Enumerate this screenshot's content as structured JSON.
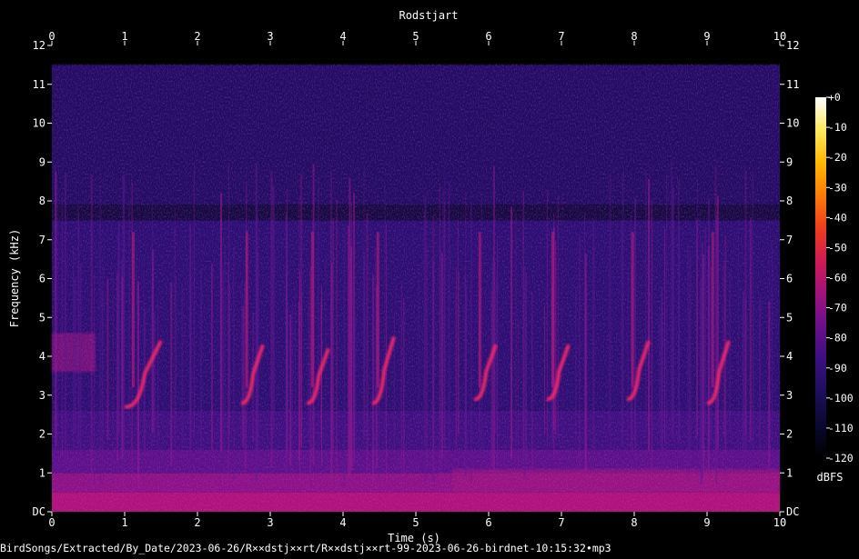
{
  "chart_data": {
    "type": "heatmap",
    "title": "Rodstjart",
    "xlabel": "Time (s)",
    "ylabel": "Frequency (kHz)",
    "xlim": [
      0,
      10
    ],
    "ylim": [
      0,
      12
    ],
    "x_ticks": [
      "0",
      "1",
      "2",
      "3",
      "4",
      "5",
      "6",
      "7",
      "8",
      "9",
      "10"
    ],
    "y_ticks": [
      "DC",
      "1",
      "2",
      "3",
      "4",
      "5",
      "6",
      "7",
      "8",
      "9",
      "10",
      "11",
      "12"
    ],
    "colorbar": {
      "label": "dBFS",
      "ticks": [
        "+0",
        "-10",
        "-20",
        "-30",
        "-40",
        "-50",
        "-60",
        "-70",
        "-80",
        "-90",
        "-100",
        "-110",
        "-120"
      ],
      "range": [
        -120,
        0
      ]
    },
    "signal_band_khz": [
      0,
      11.5
    ],
    "song_phrases": [
      {
        "start_s": 1.0,
        "end_s": 1.5,
        "freq_khz": [
          2.7,
          4.4
        ]
      },
      {
        "start_s": 2.6,
        "end_s": 2.9,
        "freq_khz": [
          2.8,
          4.3
        ]
      },
      {
        "start_s": 3.5,
        "end_s": 3.8,
        "freq_khz": [
          2.8,
          4.2
        ]
      },
      {
        "start_s": 4.4,
        "end_s": 4.7,
        "freq_khz": [
          2.8,
          4.5
        ]
      },
      {
        "start_s": 5.8,
        "end_s": 6.1,
        "freq_khz": [
          2.9,
          4.3
        ]
      },
      {
        "start_s": 6.8,
        "end_s": 7.1,
        "freq_khz": [
          2.9,
          4.3
        ]
      },
      {
        "start_s": 7.9,
        "end_s": 8.2,
        "freq_khz": [
          2.9,
          4.4
        ]
      },
      {
        "start_s": 9.0,
        "end_s": 9.3,
        "freq_khz": [
          2.8,
          4.4
        ]
      }
    ],
    "colors": [
      "#000000",
      "#0a0830",
      "#1c0f5c",
      "#3a0f80",
      "#6a0f8a",
      "#a0127e",
      "#d01a55",
      "#f03c1e",
      "#ff7a08",
      "#ffb800",
      "#ffe860",
      "#ffffff"
    ]
  },
  "footer": {
    "path": "BirdSongs/Extracted/By_Date/2023-06-26/R××dstj××rt/R××dstj××rt-99-2023-06-26-birdnet-10:15:32•mp3"
  }
}
